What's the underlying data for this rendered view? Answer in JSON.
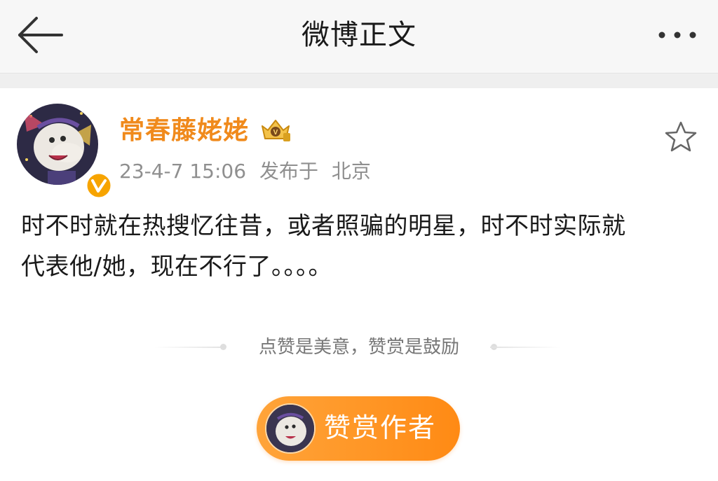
{
  "navbar": {
    "title": "微博正文",
    "back_icon": "arrow-left-icon",
    "more_icon": "more-dots-icon"
  },
  "post": {
    "username": "常春藤姥姥",
    "username_color": "#f08a1c",
    "badge_icon": "crown-vip-icon",
    "verified_icon": "verified-v-icon",
    "timestamp": "23-4-7 15:06",
    "published_label": "发布于",
    "location": "北京",
    "favorite_icon": "star-outline-icon",
    "text_line1": "时不时就在热搜忆往昔，或者照骗的明星，时不时实际就",
    "text_line2": "代表他/她，现在不行了。。。。"
  },
  "reward": {
    "hint": "点赞是美意，赞赏是鼓励",
    "button_label": "赞赏作者",
    "button_color": "#ff9a2a"
  }
}
